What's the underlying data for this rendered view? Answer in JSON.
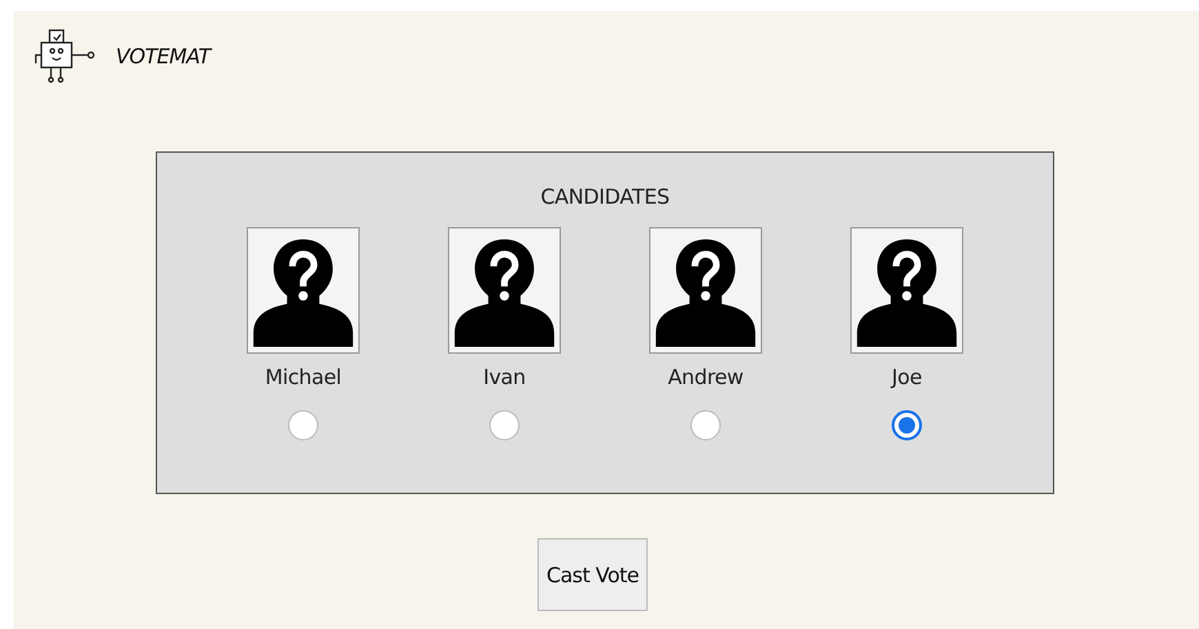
{
  "app": {
    "title": "VOTEMAT"
  },
  "panel": {
    "heading": "CANDIDATES",
    "candidates": [
      {
        "name": "Michael",
        "selected": false
      },
      {
        "name": "Ivan",
        "selected": false
      },
      {
        "name": "Andrew",
        "selected": false
      },
      {
        "name": "Joe",
        "selected": true
      }
    ]
  },
  "buttons": [
    "Cast Vote"
  ]
}
